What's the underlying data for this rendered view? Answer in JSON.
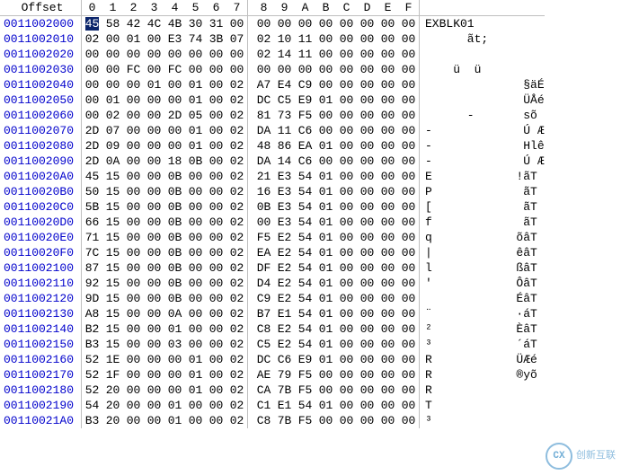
{
  "header": {
    "offset_label": "Offset",
    "columns": [
      "0",
      "1",
      "2",
      "3",
      "4",
      "5",
      "6",
      "7",
      "8",
      "9",
      "A",
      "B",
      "C",
      "D",
      "E",
      "F"
    ]
  },
  "cursor": {
    "row": 0,
    "col": 0
  },
  "rows": [
    {
      "offset": "0011002000",
      "hex": [
        "45",
        "58",
        "42",
        "4C",
        "4B",
        "30",
        "31",
        "00",
        "00",
        "00",
        "00",
        "00",
        "00",
        "00",
        "00",
        "00"
      ],
      "ascii": "EXBLK01"
    },
    {
      "offset": "0011002010",
      "hex": [
        "02",
        "00",
        "01",
        "00",
        "E3",
        "74",
        "3B",
        "07",
        "02",
        "10",
        "11",
        "00",
        "00",
        "00",
        "00",
        "00"
      ],
      "ascii": "      ãt;"
    },
    {
      "offset": "0011002020",
      "hex": [
        "00",
        "00",
        "00",
        "00",
        "00",
        "00",
        "00",
        "00",
        "02",
        "14",
        "11",
        "00",
        "00",
        "00",
        "00",
        "00"
      ],
      "ascii": ""
    },
    {
      "offset": "0011002030",
      "hex": [
        "00",
        "00",
        "FC",
        "00",
        "FC",
        "00",
        "00",
        "00",
        "00",
        "00",
        "00",
        "00",
        "00",
        "00",
        "00",
        "00"
      ],
      "ascii": "    ü  ü"
    },
    {
      "offset": "0011002040",
      "hex": [
        "00",
        "00",
        "00",
        "01",
        "00",
        "01",
        "00",
        "02",
        "A7",
        "E4",
        "C9",
        "00",
        "00",
        "00",
        "00",
        "00"
      ],
      "ascii": "              §äÉ"
    },
    {
      "offset": "0011002050",
      "hex": [
        "00",
        "01",
        "00",
        "00",
        "00",
        "01",
        "00",
        "02",
        "DC",
        "C5",
        "E9",
        "01",
        "00",
        "00",
        "00",
        "00"
      ],
      "ascii": "              ÜÅé"
    },
    {
      "offset": "0011002060",
      "hex": [
        "00",
        "02",
        "00",
        "00",
        "2D",
        "05",
        "00",
        "02",
        "81",
        "73",
        "F5",
        "00",
        "00",
        "00",
        "00",
        "00"
      ],
      "ascii": "      -       sõ"
    },
    {
      "offset": "0011002070",
      "hex": [
        "2D",
        "07",
        "00",
        "00",
        "00",
        "01",
        "00",
        "02",
        "DA",
        "11",
        "C6",
        "00",
        "00",
        "00",
        "00",
        "00"
      ],
      "ascii": "-             Ú Æ"
    },
    {
      "offset": "0011002080",
      "hex": [
        "2D",
        "09",
        "00",
        "00",
        "00",
        "01",
        "00",
        "02",
        "48",
        "86",
        "EA",
        "01",
        "00",
        "00",
        "00",
        "00"
      ],
      "ascii": "-             Hlê"
    },
    {
      "offset": "0011002090",
      "hex": [
        "2D",
        "0A",
        "00",
        "00",
        "18",
        "0B",
        "00",
        "02",
        "DA",
        "14",
        "C6",
        "00",
        "00",
        "00",
        "00",
        "00"
      ],
      "ascii": "-             Ú Æ"
    },
    {
      "offset": "00110020A0",
      "hex": [
        "45",
        "15",
        "00",
        "00",
        "0B",
        "00",
        "00",
        "02",
        "21",
        "E3",
        "54",
        "01",
        "00",
        "00",
        "00",
        "00"
      ],
      "ascii": "E            !ãT"
    },
    {
      "offset": "00110020B0",
      "hex": [
        "50",
        "15",
        "00",
        "00",
        "0B",
        "00",
        "00",
        "02",
        "16",
        "E3",
        "54",
        "01",
        "00",
        "00",
        "00",
        "00"
      ],
      "ascii": "P             ãT"
    },
    {
      "offset": "00110020C0",
      "hex": [
        "5B",
        "15",
        "00",
        "00",
        "0B",
        "00",
        "00",
        "02",
        "0B",
        "E3",
        "54",
        "01",
        "00",
        "00",
        "00",
        "00"
      ],
      "ascii": "[             ãT"
    },
    {
      "offset": "00110020D0",
      "hex": [
        "66",
        "15",
        "00",
        "00",
        "0B",
        "00",
        "00",
        "02",
        "00",
        "E3",
        "54",
        "01",
        "00",
        "00",
        "00",
        "00"
      ],
      "ascii": "f             ãT"
    },
    {
      "offset": "00110020E0",
      "hex": [
        "71",
        "15",
        "00",
        "00",
        "0B",
        "00",
        "00",
        "02",
        "F5",
        "E2",
        "54",
        "01",
        "00",
        "00",
        "00",
        "00"
      ],
      "ascii": "q            õâT"
    },
    {
      "offset": "00110020F0",
      "hex": [
        "7C",
        "15",
        "00",
        "00",
        "0B",
        "00",
        "00",
        "02",
        "EA",
        "E2",
        "54",
        "01",
        "00",
        "00",
        "00",
        "00"
      ],
      "ascii": "|            êâT"
    },
    {
      "offset": "0011002100",
      "hex": [
        "87",
        "15",
        "00",
        "00",
        "0B",
        "00",
        "00",
        "02",
        "DF",
        "E2",
        "54",
        "01",
        "00",
        "00",
        "00",
        "00"
      ],
      "ascii": "l            ßâT"
    },
    {
      "offset": "0011002110",
      "hex": [
        "92",
        "15",
        "00",
        "00",
        "0B",
        "00",
        "00",
        "02",
        "D4",
        "E2",
        "54",
        "01",
        "00",
        "00",
        "00",
        "00"
      ],
      "ascii": "'            ÔâT"
    },
    {
      "offset": "0011002120",
      "hex": [
        "9D",
        "15",
        "00",
        "00",
        "0B",
        "00",
        "00",
        "02",
        "C9",
        "E2",
        "54",
        "01",
        "00",
        "00",
        "00",
        "00"
      ],
      "ascii": "             ÉâT"
    },
    {
      "offset": "0011002130",
      "hex": [
        "A8",
        "15",
        "00",
        "00",
        "0A",
        "00",
        "00",
        "02",
        "B7",
        "E1",
        "54",
        "01",
        "00",
        "00",
        "00",
        "00"
      ],
      "ascii": "¨            ·áT"
    },
    {
      "offset": "0011002140",
      "hex": [
        "B2",
        "15",
        "00",
        "00",
        "01",
        "00",
        "00",
        "02",
        "C8",
        "E2",
        "54",
        "01",
        "00",
        "00",
        "00",
        "00"
      ],
      "ascii": "²            ÈâT"
    },
    {
      "offset": "0011002150",
      "hex": [
        "B3",
        "15",
        "00",
        "00",
        "03",
        "00",
        "00",
        "02",
        "C5",
        "E2",
        "54",
        "01",
        "00",
        "00",
        "00",
        "00"
      ],
      "ascii": "³            ´áT"
    },
    {
      "offset": "0011002160",
      "hex": [
        "52",
        "1E",
        "00",
        "00",
        "00",
        "01",
        "00",
        "02",
        "DC",
        "C6",
        "E9",
        "01",
        "00",
        "00",
        "00",
        "00"
      ],
      "ascii": "R            ÜÆé"
    },
    {
      "offset": "0011002170",
      "hex": [
        "52",
        "1F",
        "00",
        "00",
        "00",
        "01",
        "00",
        "02",
        "AE",
        "79",
        "F5",
        "00",
        "00",
        "00",
        "00",
        "00"
      ],
      "ascii": "R            ®yõ"
    },
    {
      "offset": "0011002180",
      "hex": [
        "52",
        "20",
        "00",
        "00",
        "00",
        "01",
        "00",
        "02",
        "CA",
        "7B",
        "F5",
        "00",
        "00",
        "00",
        "00",
        "00"
      ],
      "ascii": "R"
    },
    {
      "offset": "0011002190",
      "hex": [
        "54",
        "20",
        "00",
        "00",
        "01",
        "00",
        "00",
        "02",
        "C1",
        "E1",
        "54",
        "01",
        "00",
        "00",
        "00",
        "00"
      ],
      "ascii": "T"
    },
    {
      "offset": "00110021A0",
      "hex": [
        "B3",
        "20",
        "00",
        "00",
        "01",
        "00",
        "00",
        "02",
        "C8",
        "7B",
        "F5",
        "00",
        "00",
        "00",
        "00",
        "00"
      ],
      "ascii": "³"
    }
  ],
  "watermark": {
    "brand": "创新互联",
    "mark": "CX"
  }
}
